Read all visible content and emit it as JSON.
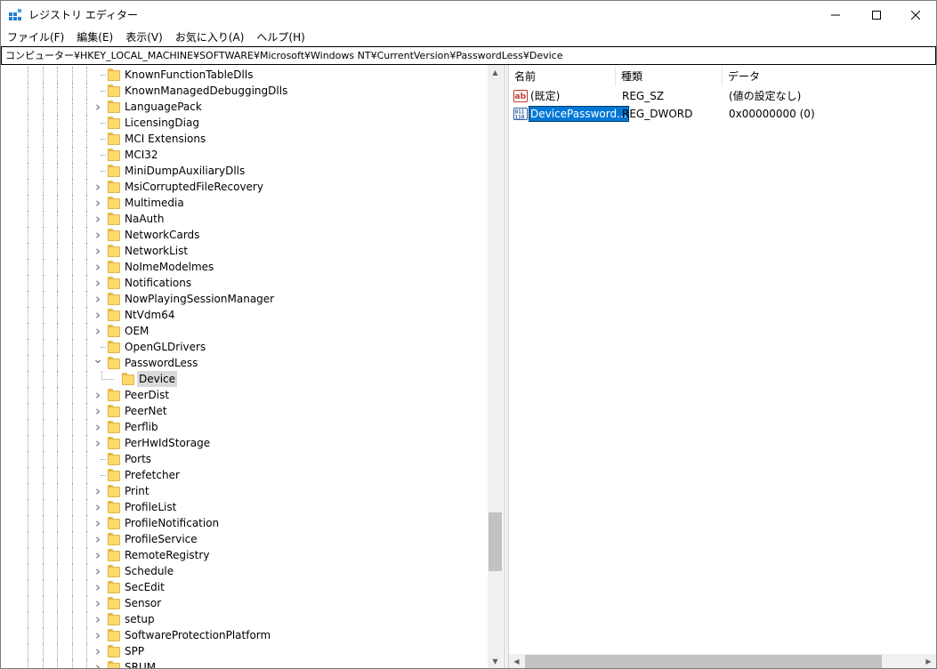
{
  "window": {
    "title": "レジストリ エディター",
    "icon": "registry-editor-icon"
  },
  "menu": [
    {
      "label": "ファイル(F)"
    },
    {
      "label": "編集(E)"
    },
    {
      "label": "表示(V)"
    },
    {
      "label": "お気に入り(A)"
    },
    {
      "label": "ヘルプ(H)"
    }
  ],
  "address": {
    "path": "コンピューター¥HKEY_LOCAL_MACHINE¥SOFTWARE¥Microsoft¥Windows NT¥CurrentVersion¥PasswordLess¥Device"
  },
  "tree": {
    "items": [
      {
        "label": "KnownFunctionTableDlls",
        "expander": "none"
      },
      {
        "label": "KnownManagedDebuggingDlls",
        "expander": "none"
      },
      {
        "label": "LanguagePack",
        "expander": "collapsed"
      },
      {
        "label": "LicensingDiag",
        "expander": "none"
      },
      {
        "label": "MCI Extensions",
        "expander": "none"
      },
      {
        "label": "MCI32",
        "expander": "none"
      },
      {
        "label": "MiniDumpAuxiliaryDlls",
        "expander": "none"
      },
      {
        "label": "MsiCorruptedFileRecovery",
        "expander": "collapsed"
      },
      {
        "label": "Multimedia",
        "expander": "collapsed"
      },
      {
        "label": "NaAuth",
        "expander": "collapsed"
      },
      {
        "label": "NetworkCards",
        "expander": "collapsed"
      },
      {
        "label": "NetworkList",
        "expander": "collapsed"
      },
      {
        "label": "NoImeModelmes",
        "expander": "collapsed"
      },
      {
        "label": "Notifications",
        "expander": "collapsed"
      },
      {
        "label": "NowPlayingSessionManager",
        "expander": "collapsed"
      },
      {
        "label": "NtVdm64",
        "expander": "collapsed"
      },
      {
        "label": "OEM",
        "expander": "collapsed"
      },
      {
        "label": "OpenGLDrivers",
        "expander": "none"
      },
      {
        "label": "PasswordLess",
        "expander": "expanded"
      },
      {
        "label": "Device",
        "expander": "none",
        "child": true,
        "selected": true
      },
      {
        "label": "PeerDist",
        "expander": "collapsed"
      },
      {
        "label": "PeerNet",
        "expander": "collapsed"
      },
      {
        "label": "Perflib",
        "expander": "collapsed"
      },
      {
        "label": "PerHwIdStorage",
        "expander": "collapsed"
      },
      {
        "label": "Ports",
        "expander": "none"
      },
      {
        "label": "Prefetcher",
        "expander": "none"
      },
      {
        "label": "Print",
        "expander": "collapsed"
      },
      {
        "label": "ProfileList",
        "expander": "collapsed"
      },
      {
        "label": "ProfileNotification",
        "expander": "collapsed"
      },
      {
        "label": "ProfileService",
        "expander": "collapsed"
      },
      {
        "label": "RemoteRegistry",
        "expander": "collapsed"
      },
      {
        "label": "Schedule",
        "expander": "collapsed"
      },
      {
        "label": "SecEdit",
        "expander": "collapsed"
      },
      {
        "label": "Sensor",
        "expander": "collapsed"
      },
      {
        "label": "setup",
        "expander": "collapsed"
      },
      {
        "label": "SoftwareProtectionPlatform",
        "expander": "collapsed"
      },
      {
        "label": "SPP",
        "expander": "collapsed"
      },
      {
        "label": "SRUM",
        "expander": "collapsed"
      }
    ]
  },
  "list": {
    "columns": [
      {
        "label": "名前"
      },
      {
        "label": "種類"
      },
      {
        "label": "データ"
      }
    ],
    "rows": [
      {
        "name": "(既定)",
        "type": "REG_SZ",
        "data": "(値の設定なし)",
        "icon": "reg-string-icon",
        "selected": false
      },
      {
        "name": "DevicePassword...",
        "type": "REG_DWORD",
        "data": "0x00000000 (0)",
        "icon": "reg-binary-icon",
        "selected": true
      }
    ]
  },
  "colors": {
    "selection": "#0078d7",
    "folder": "#ffd96b"
  }
}
